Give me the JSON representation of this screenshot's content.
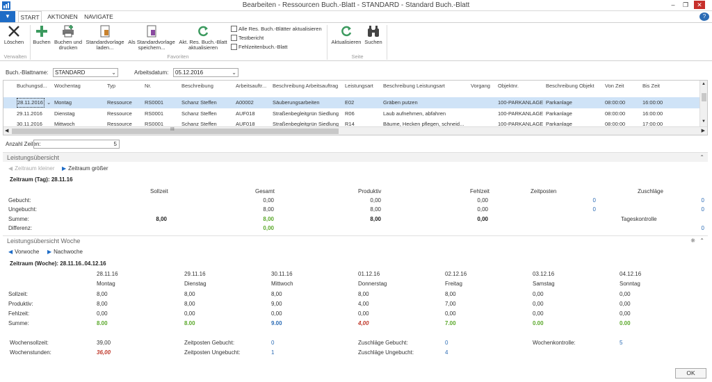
{
  "window": {
    "title": "Bearbeiten - Ressourcen Buch.-Blatt - STANDARD - Standard Buch.-Blatt"
  },
  "ribbon": {
    "tabs": [
      "START",
      "AKTIONEN",
      "NAVIGATE"
    ],
    "groups": {
      "verwalten": "Verwalten",
      "favoriten": "Favoriten",
      "seite": "Seite"
    },
    "buttons": {
      "loeschen": "Löschen",
      "buchen": "Buchen",
      "buchen_drucken_1": "Buchen und",
      "buchen_drucken_2": "drucken",
      "standardvorlage_laden_1": "Standardvorlage",
      "standardvorlage_laden_2": "laden...",
      "als_standardvorlage_1": "Als Standardvorlage",
      "als_standardvorlage_2": "speichern...",
      "akt_res_1": "Akt. Res. Buch.-Blatt",
      "akt_res_2": "aktualisieren",
      "alle_res": "Alle Res. Buch.-Blätter aktualisieren",
      "testbericht": "Testbericht",
      "fehlzeiten": "Fehlzeitenbuch.-Blatt",
      "aktualisieren": "Aktualisieren",
      "suchen": "Suchen"
    },
    "colors": {
      "accent": "#1e6cc6",
      "green_icon": "#3c9a5f"
    }
  },
  "filters": {
    "blattname_label": "Buch.-Blattname:",
    "blattname_value": "STANDARD",
    "arbeitsdatum_label": "Arbeitsdatum:",
    "arbeitsdatum_value": "05.12.2016"
  },
  "grid": {
    "columns": [
      "Buchungsd...",
      "Wochentag",
      "Typ",
      "Nr.",
      "Beschreibung",
      "Arbeitsauftr...",
      "Beschreibung Arbeitsauftrag",
      "Leistungsart",
      "Beschreibung Leistungsart",
      "Vorgang",
      "Objektnr.",
      "Beschreibung Objekt",
      "Von Zeit",
      "Bis Zeit"
    ],
    "rows": [
      [
        "28.11.2016",
        "Montag",
        "Ressource",
        "RS0001",
        "Schanz Steffen",
        "A00002",
        "Säuberungsarbeiten",
        "E02",
        "Gräben putzen",
        "",
        "100-PARKANLAGE",
        "Parkanlage",
        "08:00:00",
        "16:00:00"
      ],
      [
        "29.11.2016",
        "Dienstag",
        "Ressource",
        "RS0001",
        "Schanz Steffen",
        "AUF018",
        "Straßenbegleitgrün Siedlung",
        "R06",
        "Laub aufnehmen, abfahren",
        "",
        "100-PARKANLAGE",
        "Parkanlage",
        "08:00:00",
        "16:00:00"
      ],
      [
        "30.11.2016",
        "Mittwoch",
        "Ressource",
        "RS0001",
        "Schanz Steffen",
        "AUF018",
        "Straßenbegleitgrün Siedlung",
        "R14",
        "Bäume, Hecken pflegen, schneid...",
        "",
        "100-PARKANLAGE",
        "Parkanlage",
        "08:00:00",
        "17:00:00"
      ]
    ],
    "hscroll_label": "III"
  },
  "count": {
    "label": "Anzahl Zeilen:",
    "value": "5"
  },
  "leistung": {
    "title": "Leistungsübersicht",
    "nav_smaller": "Zeitraum kleiner",
    "nav_larger": "Zeitraum größer",
    "period": "Zeitraum (Tag): 28.11.16",
    "headers": [
      "Sollzeit",
      "Gesamt",
      "Produktiv",
      "Fehlzeit",
      "Zeitposten",
      "Zuschläge"
    ],
    "rows": [
      {
        "label": "Gebucht:",
        "sollzeit": "",
        "gesamt": "0,00",
        "produktiv": "0,00",
        "fehlzeit": "0,00",
        "zeitposten": "0",
        "zuschlaege": "0"
      },
      {
        "label": "Ungebucht:",
        "sollzeit": "",
        "gesamt": "8,00",
        "produktiv": "8,00",
        "fehlzeit": "0,00",
        "zeitposten": "0",
        "zuschlaege": "0"
      },
      {
        "label": "Summe:",
        "sollzeit": "8,00",
        "gesamt": "8,00",
        "produktiv": "8,00",
        "fehlzeit": "0,00",
        "zeitposten": "",
        "zuschlaege": ""
      },
      {
        "label": "Differenz:",
        "sollzeit": "",
        "gesamt": "0,00",
        "produktiv": "",
        "fehlzeit": "",
        "zeitposten": "",
        "zuschlaege": ""
      }
    ],
    "tageskontrolle_label": "Tageskontrolle",
    "tageskontrolle_value": "0"
  },
  "woche": {
    "title": "Leistungsübersicht Woche",
    "nav_prev": "Vorwoche",
    "nav_next": "Nachwoche",
    "period": "Zeitraum (Woche): 28.11.16..04.12.16",
    "days": [
      {
        "date": "28.11.16",
        "name": "Montag",
        "soll": "8,00",
        "prod": "8,00",
        "fehl": "0,00",
        "summe": "8.00",
        "style": "green"
      },
      {
        "date": "29.11.16",
        "name": "Dienstag",
        "soll": "8,00",
        "prod": "8,00",
        "fehl": "0,00",
        "summe": "8.00",
        "style": "green"
      },
      {
        "date": "30.11.16",
        "name": "Mittwoch",
        "soll": "8,00",
        "prod": "9,00",
        "fehl": "0,00",
        "summe": "9.00",
        "style": "blueb"
      },
      {
        "date": "01.12.16",
        "name": "Donnerstag",
        "soll": "8,00",
        "prod": "4,00",
        "fehl": "0,00",
        "summe": "4,00",
        "style": "redb"
      },
      {
        "date": "02.12.16",
        "name": "Freitag",
        "soll": "8,00",
        "prod": "7,00",
        "fehl": "0,00",
        "summe": "7.00",
        "style": "green"
      },
      {
        "date": "03.12.16",
        "name": "Samstag",
        "soll": "0,00",
        "prod": "0,00",
        "fehl": "0,00",
        "summe": "0.00",
        "style": "green"
      },
      {
        "date": "04.12.16",
        "name": "Sonntag",
        "soll": "0,00",
        "prod": "0,00",
        "fehl": "0,00",
        "summe": "0.00",
        "style": "green"
      }
    ],
    "row_labels": {
      "soll": "Sollzeit:",
      "prod": "Produktiv:",
      "fehl": "Fehlzeit:",
      "summe": "Summe:"
    },
    "summary": {
      "wochensollzeit_label": "Wochensollzeit:",
      "wochensollzeit_value": "39,00",
      "wochenstunden_label": "Wochenstunden:",
      "wochenstunden_value": "36,00",
      "zp_gebucht_label": "Zeitposten Gebucht:",
      "zp_gebucht_value": "0",
      "zp_ungebucht_label": "Zeitposten Ungebucht:",
      "zp_ungebucht_value": "1",
      "zu_gebucht_label": "Zuschläge Gebucht:",
      "zu_gebucht_value": "0",
      "zu_ungebucht_label": "Zuschläge Ungebucht:",
      "zu_ungebucht_value": "4",
      "wochenkontrolle_label": "Wochenkontrolle:",
      "wochenkontrolle_value": "5"
    }
  },
  "footer": {
    "ok_label": "OK"
  }
}
